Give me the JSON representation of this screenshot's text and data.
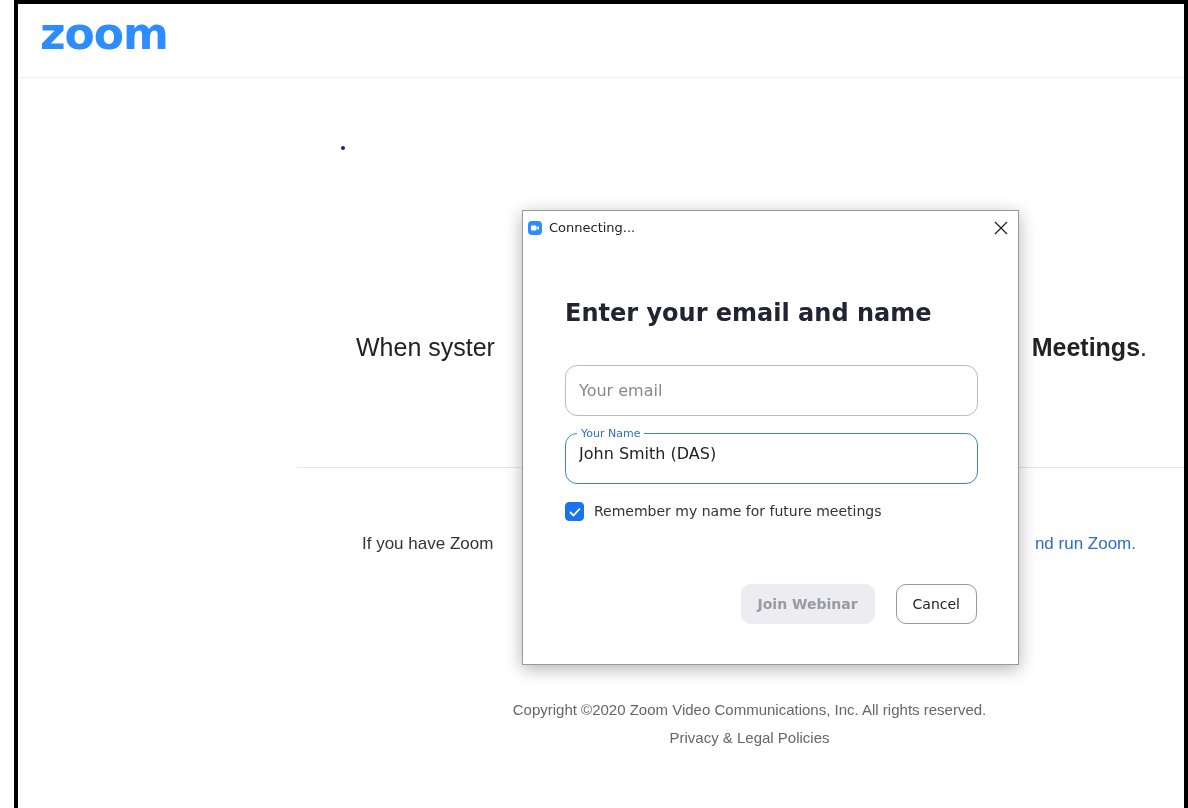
{
  "page": {
    "logo": "zoom",
    "headline_left": "When syster",
    "headline_right": "**Meetings**.",
    "prompt_left": "If you have Zoom",
    "prompt_link": "nd run Zoom.",
    "copyright": "Copyright ©2020 Zoom Video Communications, Inc. All rights reserved.",
    "legal_link": "Privacy & Legal Policies"
  },
  "dialog": {
    "title": "Connecting...",
    "heading": "Enter your email and name",
    "email_field": {
      "placeholder": "Your email"
    },
    "name_field": {
      "label": "Your Name",
      "value": "John Smith (DAS)",
      "focused": true
    },
    "remember": {
      "label": "Remember my name for future meetings",
      "checked": true
    },
    "buttons": [
      {
        "label": "Join Webinar",
        "disabled": true
      },
      {
        "label": "Cancel",
        "disabled": false
      }
    ]
  }
}
